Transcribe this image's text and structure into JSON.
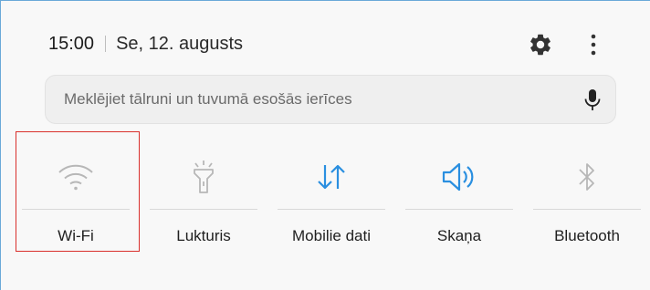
{
  "status": {
    "time": "15:00",
    "date": "Se, 12. augusts"
  },
  "header_icons": {
    "settings": "gear-icon",
    "more": "more-vert-icon"
  },
  "search": {
    "placeholder": "Meklējiet tālruni un tuvumā esošās ierīces",
    "mic_icon": "microphone-icon"
  },
  "quick_tiles": [
    {
      "label": "Wi-Fi",
      "icon": "wifi-icon",
      "active": false,
      "highlighted": true
    },
    {
      "label": "Lukturis",
      "icon": "flashlight-icon",
      "active": false
    },
    {
      "label": "Mobilie dati",
      "icon": "mobile-data-icon",
      "active": true
    },
    {
      "label": "Skaņa",
      "icon": "sound-icon",
      "active": true
    },
    {
      "label": "Bluetooth",
      "icon": "bluetooth-icon",
      "active": false
    }
  ],
  "colors": {
    "active": "#2a8fe0",
    "inactive": "#b7b7b7",
    "highlight": "#d9302c",
    "panel": "#f8f8f8"
  }
}
